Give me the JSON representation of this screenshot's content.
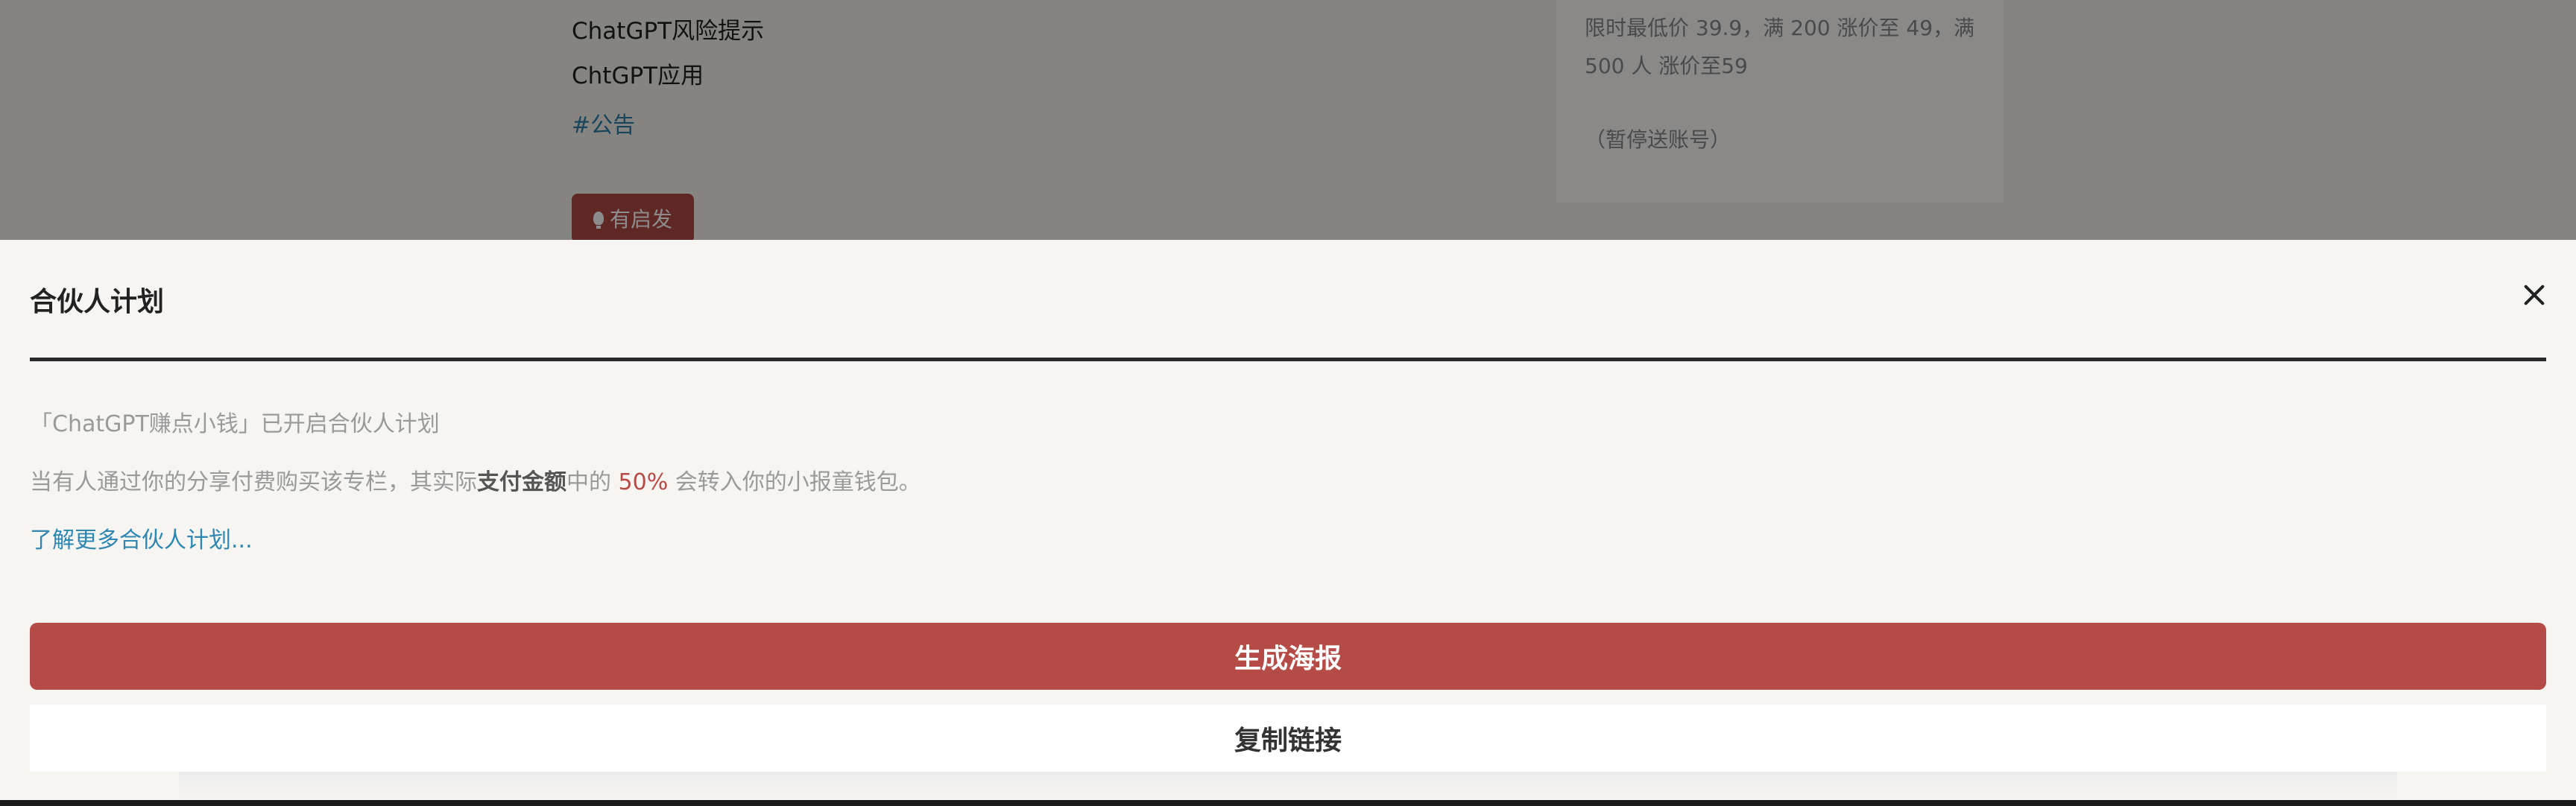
{
  "background": {
    "lines": [
      "ChatGPT风险提示",
      "ChtGPT应用"
    ],
    "tag": "#公告",
    "inspire_button": "有启发",
    "card_text": "限时最低价 39.9，满 200 涨价至 49，满 500 人 涨价至59",
    "card_note": "（暂停送账号）"
  },
  "dialog": {
    "title": "合伙人计划",
    "intro": "「ChatGPT赚点小钱」已开启合伙人计划",
    "desc_part1": "当有人通过你的分享付费购买该专栏，其实际",
    "desc_bold": "支付金额",
    "desc_part2": "中的",
    "desc_percent": "50%",
    "desc_part3": "会转入你的小报童钱包。",
    "learn_more": "了解更多合伙人计划...",
    "poster_button": "生成海报",
    "copy_button": "复制链接"
  },
  "colors": {
    "accent": "#b44b46",
    "link": "#2d87b0"
  },
  "icons": [
    "bulb-icon",
    "close-icon"
  ]
}
